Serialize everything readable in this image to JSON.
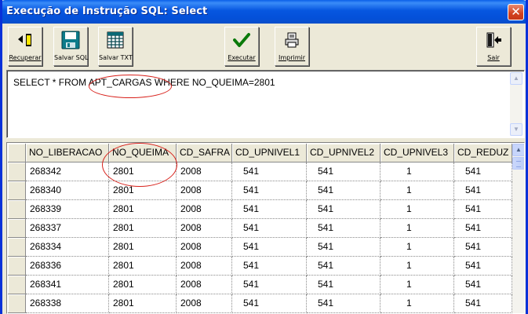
{
  "window": {
    "title": "Execução de Instrução SQL: Select",
    "close_label": "✕"
  },
  "toolbar": {
    "recuperar": "Recuperar",
    "salvar_sql": "Salvar SQL",
    "salvar_txt": "Salvar TXT",
    "executar": "Executar",
    "imprimir": "Imprimir",
    "sair": "Sair"
  },
  "query": {
    "text": "SELECT * FROM APT_CARGAS WHERE NO_QUEIMA=2801"
  },
  "annotation_color": "#d8201a",
  "grid": {
    "columns": [
      "NO_LIBERACAO",
      "NO_QUEIMA",
      "CD_SAFRA",
      "CD_UPNIVEL1",
      "CD_UPNIVEL2",
      "CD_UPNIVEL3",
      "CD_REDUZ"
    ],
    "rows": [
      [
        "268342",
        "2801",
        "2008",
        "541",
        "541",
        "1",
        "541"
      ],
      [
        "268340",
        "2801",
        "2008",
        "541",
        "541",
        "1",
        "541"
      ],
      [
        "268339",
        "2801",
        "2008",
        "541",
        "541",
        "1",
        "541"
      ],
      [
        "268337",
        "2801",
        "2008",
        "541",
        "541",
        "1",
        "541"
      ],
      [
        "268334",
        "2801",
        "2008",
        "541",
        "541",
        "1",
        "541"
      ],
      [
        "268336",
        "2801",
        "2008",
        "541",
        "541",
        "1",
        "541"
      ],
      [
        "268341",
        "2801",
        "2008",
        "541",
        "541",
        "1",
        "541"
      ],
      [
        "268338",
        "2801",
        "2008",
        "541",
        "541",
        "1",
        "541"
      ]
    ]
  }
}
